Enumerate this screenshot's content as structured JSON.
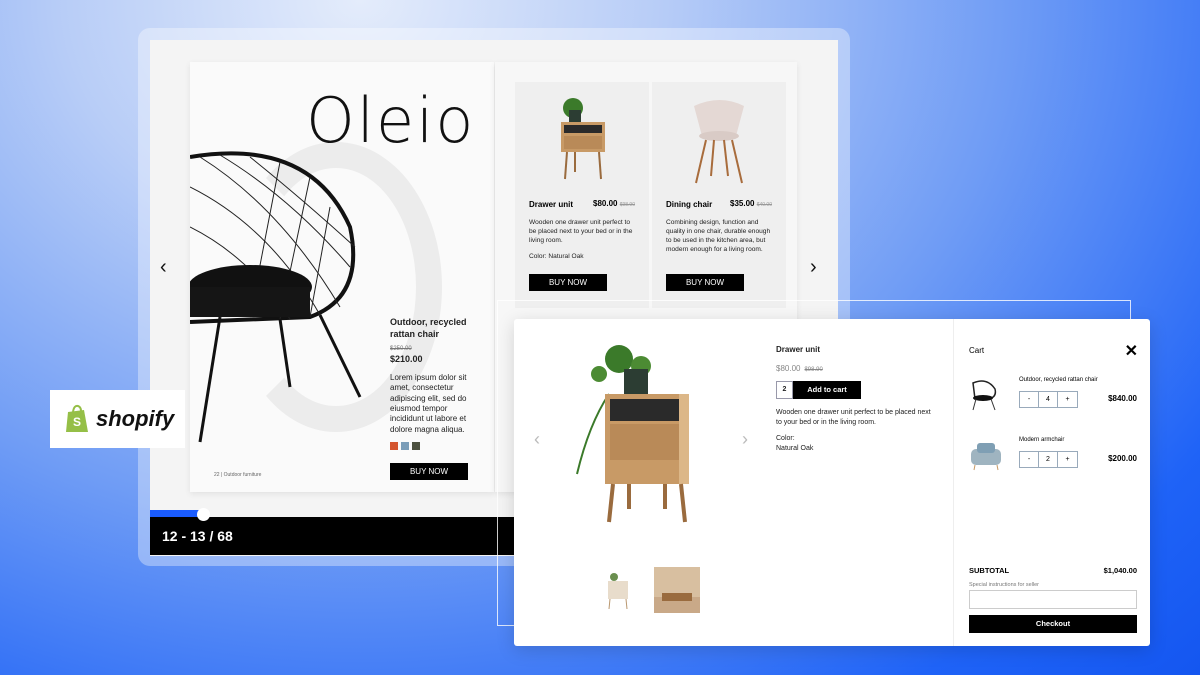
{
  "flipbook": {
    "brand": "Oleio",
    "page_indicator": "12 - 13 / 68",
    "progress": 0.18,
    "footer": "22 | Outdoor furniture",
    "featured": {
      "title": "Outdoor, recycled rattan chair",
      "old_price": "$250.00",
      "price": "$210.00",
      "description": "Lorem ipsum dolor sit amet, consectetur adipiscing elit, sed do eiusmod tempor incididunt ut labore et dolore magna aliqua.",
      "swatches": [
        "#d4552f",
        "#7a9db8",
        "#4d5140"
      ],
      "button": "BUY NOW"
    },
    "products": [
      {
        "title": "Drawer unit",
        "price": "$80.00",
        "old_price": "$98.90",
        "description": "Wooden one drawer unit perfect to be placed next to your bed or in the living room.",
        "color": "Color: Natural Oak",
        "button": "BUY NOW"
      },
      {
        "title": "Dining chair",
        "price": "$35.00",
        "old_price": "$40.00",
        "description": "Combining design, function and quality in one chair, durable enough to be used in the kitchen area, but modern enough for a living room.",
        "button": "BUY NOW"
      }
    ]
  },
  "badge": {
    "text": "shopify"
  },
  "quick_view": {
    "title": "Drawer unit",
    "price": "$80.00",
    "old_price": "$98.90",
    "quantity": "2",
    "add_button": "Add to cart",
    "description": "Wooden one drawer unit perfect to be placed next to your bed or in the living room.",
    "color_label": "Color:",
    "color_value": "Natural Oak"
  },
  "cart": {
    "title": "Cart",
    "items": [
      {
        "name": "Outdoor, recycled rattan chair",
        "qty": "4",
        "price": "$840.00"
      },
      {
        "name": "Modern armchair",
        "qty": "2",
        "price": "$200.00"
      }
    ],
    "minus": "-",
    "plus": "+",
    "subtotal_label": "SUBTOTAL",
    "subtotal": "$1,040.00",
    "instructions_label": "Special instructions for seller",
    "checkout": "Checkout"
  }
}
